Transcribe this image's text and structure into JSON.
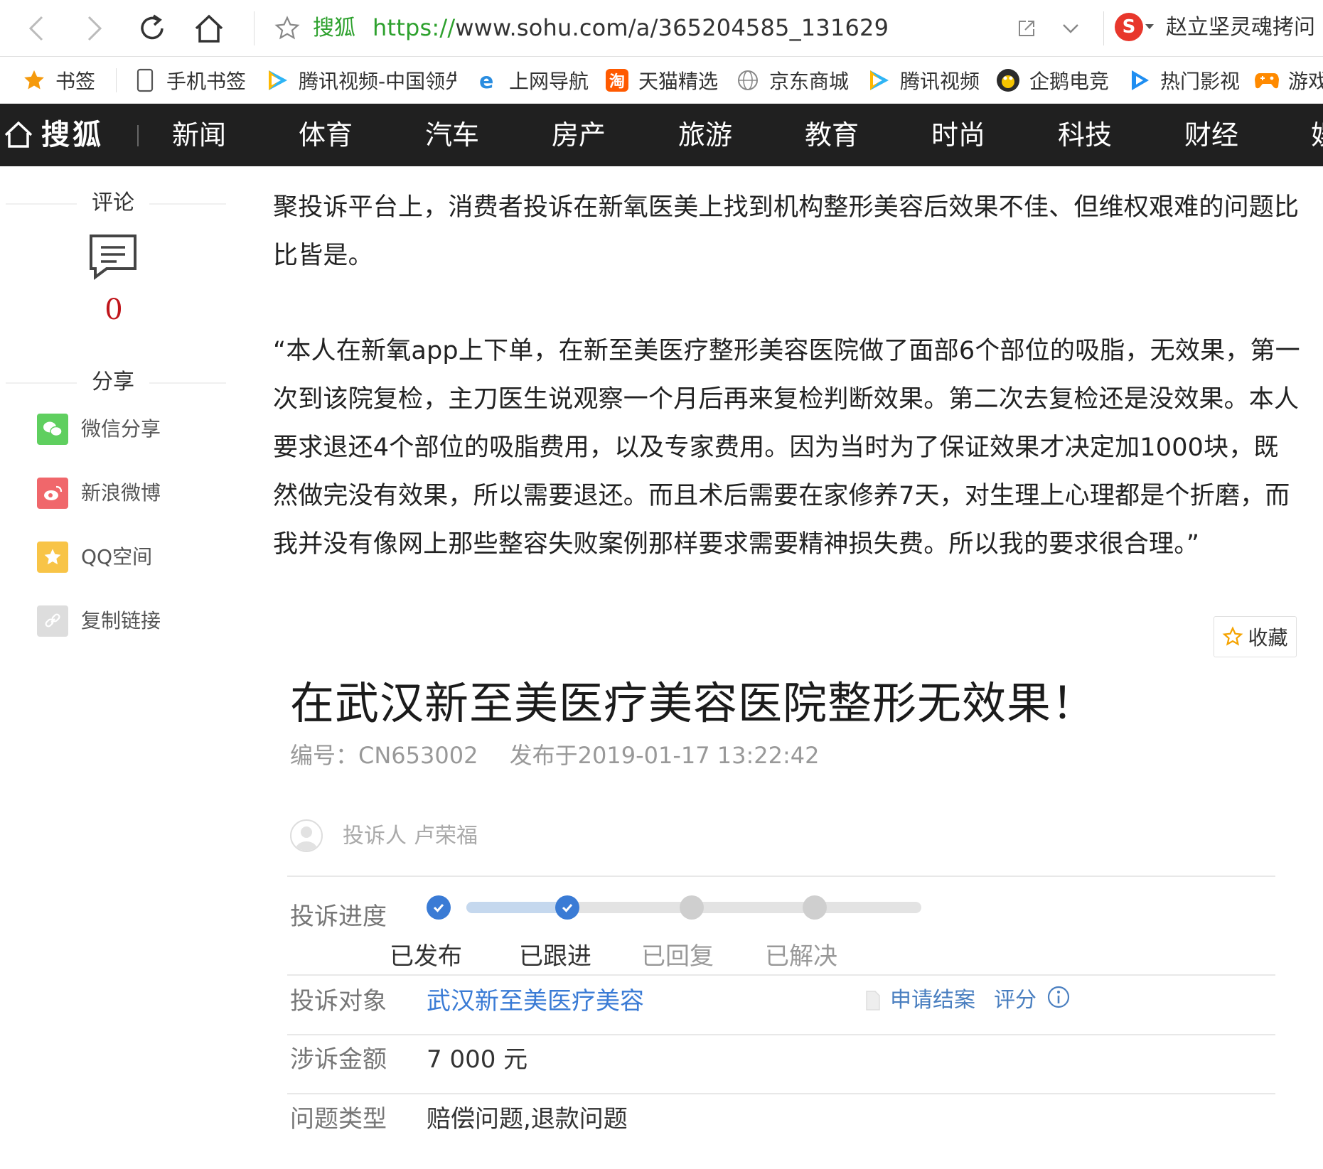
{
  "browser": {
    "site_name": "搜狐",
    "url_protocol": "https://",
    "url_rest": "www.sohu.com/a/365204585_131629",
    "search_hint": "赵立坚灵魂拷问",
    "search_engine_logo": "S"
  },
  "bookmarks": [
    {
      "label": "书签",
      "icon": "star-icon"
    },
    {
      "label": "手机书签",
      "icon": "phone-icon"
    },
    {
      "label": "腾讯视频-中国领先",
      "icon": "tencent-video-icon"
    },
    {
      "label": "上网导航",
      "icon": "ie-icon"
    },
    {
      "label": "天猫精选",
      "icon": "tmall-icon"
    },
    {
      "label": "京东商城",
      "icon": "globe-icon"
    },
    {
      "label": "腾讯视频",
      "icon": "tencent-video-icon"
    },
    {
      "label": "企鹅电竞",
      "icon": "penguin-icon"
    },
    {
      "label": "热门影视",
      "icon": "play-icon"
    },
    {
      "label": "游戏",
      "icon": "gamepad-icon"
    }
  ],
  "sohu_nav": {
    "brand": "搜狐",
    "items": [
      "新闻",
      "体育",
      "汽车",
      "房产",
      "旅游",
      "教育",
      "时尚",
      "科技",
      "财经",
      "娱"
    ]
  },
  "sidebar": {
    "comment_title": "评论",
    "comment_count": "0",
    "share_title": "分享",
    "share_items": [
      {
        "label": "微信分享",
        "icon": "wechat-icon",
        "color": "#5fcf5f"
      },
      {
        "label": "新浪微博",
        "icon": "weibo-icon",
        "color": "#f0676b"
      },
      {
        "label": "QQ空间",
        "icon": "qzone-icon",
        "color": "#f8c447"
      },
      {
        "label": "复制链接",
        "icon": "link-icon",
        "color": "#dddddd"
      }
    ]
  },
  "article": {
    "paragraphs": [
      "聚投诉平台上，消费者投诉在新氧医美上找到机构整形美容后效果不佳、但维权艰难的问题比比皆是。",
      "“本人在新氧app上下单，在新至美医疗整形美容医院做了面部6个部位的吸脂，无效果，第一次到该院复检，主刀医生说观察一个月后再来复检判断效果。第二次去复检还是没效果。本人要求退还4个部位的吸脂费用，以及专家费用。因为当时为了保证效果才决定加1000块，既然做完没有效果，所以需要退还。而且术后需要在家修养7天，对生理上心理都是个折磨，而我并没有像网上那些整容失败案例那样要求需要精神损失费。所以我的要求很合理。”"
    ],
    "favorite_label": "收藏"
  },
  "complaint": {
    "title": "在武汉新至美医疗美容医院整形无效果！",
    "number": "编号：CN653002",
    "published": "发布于2019-01-17 13:22:42",
    "complainant_label": "投诉人",
    "complainant_name": "卢荣福",
    "progress_label": "投诉进度",
    "steps": [
      {
        "label": "已发布",
        "done": true
      },
      {
        "label": "已跟进",
        "done": true
      },
      {
        "label": "已回复",
        "done": false
      },
      {
        "label": "已解决",
        "done": false
      }
    ],
    "target_label": "投诉对象",
    "target_value": "武汉新至美医疗美容",
    "apply_close_label": "申请结案",
    "rate_label": "评分",
    "amount_label": "涉诉金额",
    "amount_value": "7 000 元",
    "type_label": "问题类型",
    "type_value": "赔偿问题,退款问题",
    "accent_color": "#3a7bd5"
  }
}
